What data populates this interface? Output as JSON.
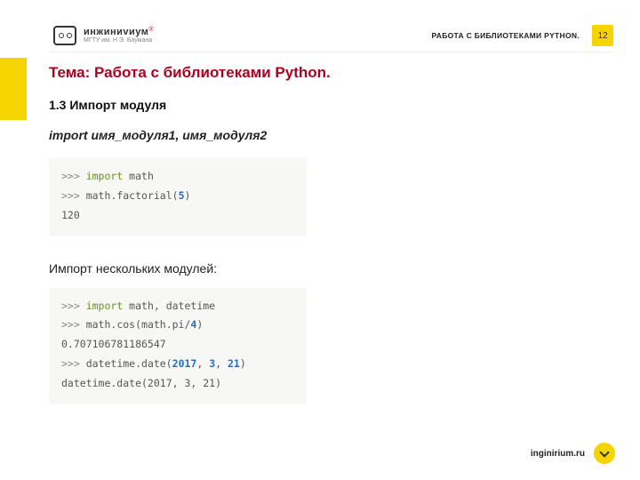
{
  "header": {
    "brand_main": "инжиниvиум",
    "brand_sub": "МГТУ им. Н.Э. Баумана",
    "brand_r": "®",
    "course_title": "РАБОТА С БИБЛИОТЕКАМИ PYTHON.",
    "page_number": "12"
  },
  "topic": "Тема: Работа с библиотеками Python.",
  "section": "1.3 Импорт модуля",
  "syntax": "import имя_модуля1, имя_модуля2",
  "code1": {
    "l1_prompt": ">>> ",
    "l1_kw": "import",
    "l1_rest": " math",
    "l2_prompt": ">>> ",
    "l2_a": "math.factorial(",
    "l2_num": "5",
    "l2_b": ")",
    "l3": "120"
  },
  "subhead": "Импорт нескольких модулей:",
  "code2": {
    "l1_prompt": ">>> ",
    "l1_kw": "import",
    "l1_rest": " math, datetime",
    "l2_prompt": ">>> ",
    "l2_a": "math.cos(math.pi/",
    "l2_num": "4",
    "l2_b": ")",
    "l3": "0.707106781186547",
    "l4_prompt": ">>> ",
    "l4_a": "datetime.date(",
    "l4_n1": "2017",
    "l4_s1": ", ",
    "l4_n2": "3",
    "l4_s2": ", ",
    "l4_n3": "21",
    "l4_b": ")",
    "l5": "datetime.date(2017, 3, 21)"
  },
  "footer": {
    "url": "inginirium.ru"
  }
}
